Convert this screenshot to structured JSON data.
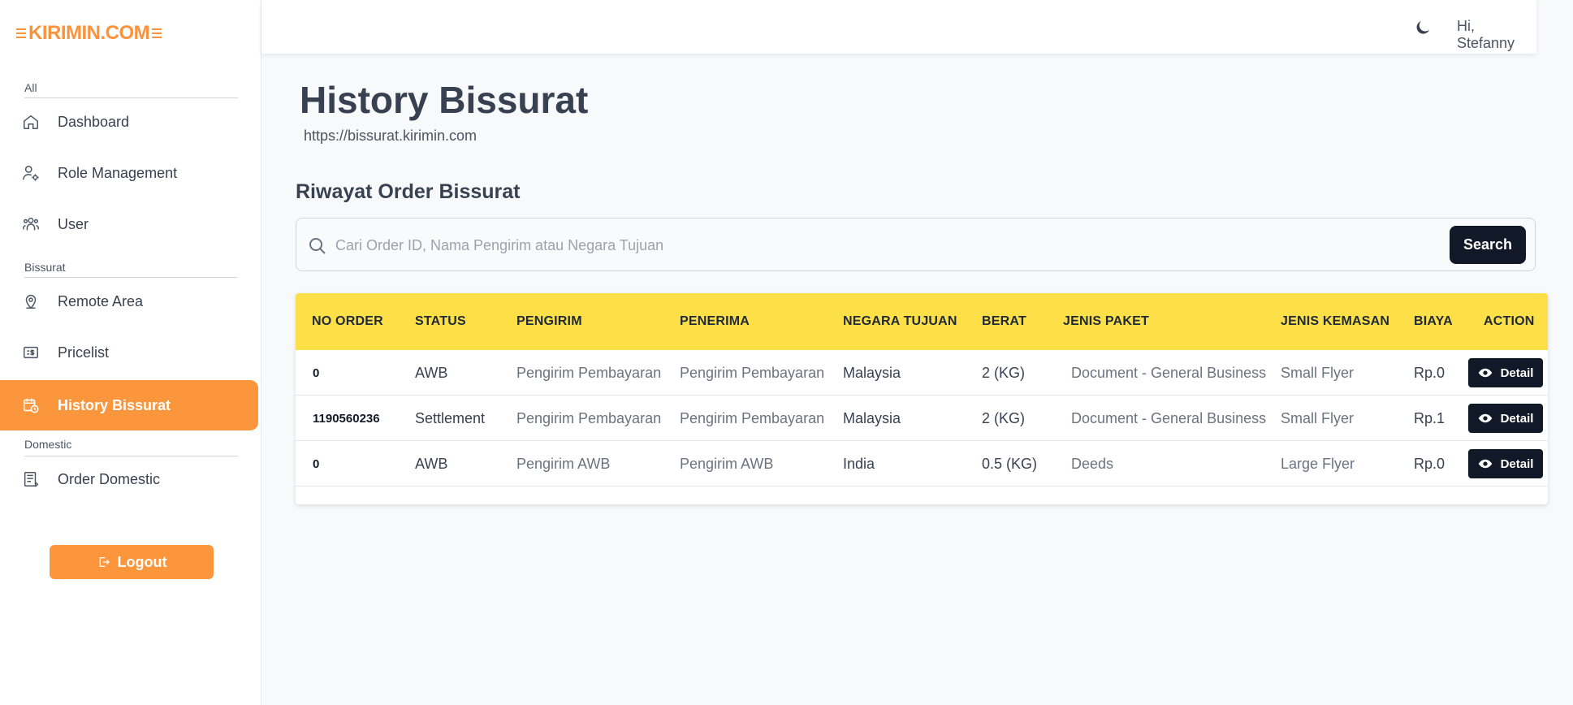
{
  "brand": {
    "logo_text": "KIRIMIN.COM",
    "accent": "#fb963d"
  },
  "sidebar": {
    "sections": [
      {
        "label": "All"
      },
      {
        "label": "Bissurat"
      },
      {
        "label": "Domestic"
      }
    ],
    "items": [
      {
        "label": "Dashboard",
        "icon": "home-icon"
      },
      {
        "label": "Role Management",
        "icon": "user-gear-icon"
      },
      {
        "label": "User",
        "icon": "users-icon"
      },
      {
        "label": "Remote Area",
        "icon": "map-pin-icon"
      },
      {
        "label": "Pricelist",
        "icon": "price-tag-icon"
      },
      {
        "label": "History Bissurat",
        "icon": "calendar-clock-icon",
        "active": true
      },
      {
        "label": "Order Domestic",
        "icon": "order-list-icon"
      }
    ],
    "logout_label": "Logout"
  },
  "header": {
    "greeting": "Hi, Stefanny",
    "theme_icon": "moon-icon"
  },
  "main": {
    "title": "History Bissurat",
    "subtitle": "https://bissurat.kirimin.com",
    "section_title": "Riwayat Order Bissurat",
    "search": {
      "placeholder": "Cari Order ID, Nama Pengirim atau Negara Tujuan",
      "value": "",
      "button_label": "Search"
    }
  },
  "table": {
    "columns": [
      "NO ORDER",
      "STATUS",
      "PENGIRIM",
      "PENERIMA",
      "NEGARA TUJUAN",
      "BERAT",
      "JENIS PAKET",
      "JENIS KEMASAN",
      "BIAYA",
      "ACTION"
    ],
    "rows": [
      {
        "no_order": "0",
        "status": "AWB",
        "pengirim": "Pengirim Pembayaran",
        "penerima": "Pengirim Pembayaran",
        "negara": "Malaysia",
        "berat": "2 (KG)",
        "paket": "Document - General Business",
        "kemasan": "Small Flyer",
        "biaya": "Rp.0",
        "action": "Detail"
      },
      {
        "no_order": "1190560236",
        "status": "Settlement",
        "pengirim": "Pengirim Pembayaran",
        "penerima": "Pengirim Pembayaran",
        "negara": "Malaysia",
        "berat": "2 (KG)",
        "paket": "Document - General Business",
        "kemasan": "Small Flyer",
        "biaya": "Rp.1",
        "action": "Detail"
      },
      {
        "no_order": "0",
        "status": "AWB",
        "pengirim": "Pengirim AWB",
        "penerima": "Pengirim AWB",
        "negara": "India",
        "berat": "0.5 (KG)",
        "paket": "Deeds",
        "kemasan": "Large Flyer",
        "biaya": "Rp.0",
        "action": "Detail"
      }
    ]
  }
}
